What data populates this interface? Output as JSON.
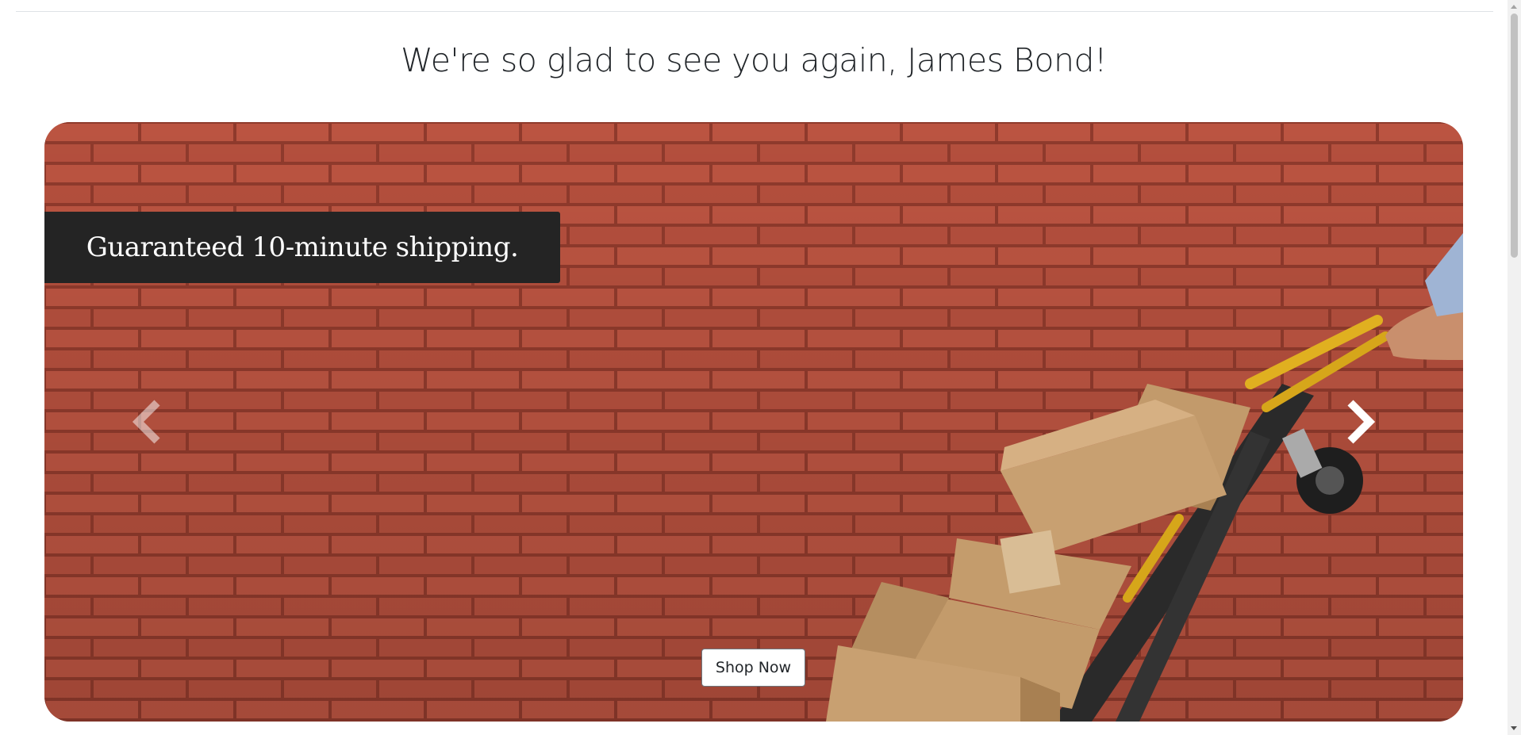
{
  "greeting": "We're so glad to see you again, James Bond!",
  "carousel": {
    "caption": "Guaranteed 10-minute shipping.",
    "cta_label": "Shop Now",
    "prev_icon": "chevron-left-icon",
    "next_icon": "chevron-right-icon",
    "image_description_icon": "brick-wall-hand-truck-image"
  },
  "colors": {
    "brick": "#b5503d",
    "caption_bg": "#242424",
    "text": "#212529"
  }
}
